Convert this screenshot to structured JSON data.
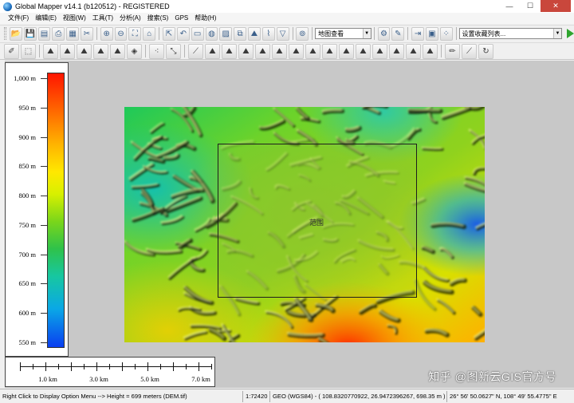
{
  "window": {
    "title": "Global Mapper v14.1 (b120512) - REGISTERED",
    "minimize": "—",
    "maximize": "☐",
    "close": "✕"
  },
  "menu": [
    "文件(F)",
    "编辑(E)",
    "视图(W)",
    "工具(T)",
    "分析(A)",
    "搜索(S)",
    "GPS",
    "帮助(H)"
  ],
  "toolbar": {
    "layer_combo": "地图查看",
    "config_combo": "设置收藏列表..."
  },
  "legend": {
    "unit": "m",
    "min": 540,
    "max": 1010,
    "ticks": [
      "1,000 m",
      "950 m",
      "900 m",
      "850 m",
      "800 m",
      "750 m",
      "700 m",
      "650 m",
      "600 m",
      "550 m"
    ],
    "tick_values": [
      1000,
      950,
      900,
      850,
      800,
      750,
      700,
      650,
      600,
      550
    ]
  },
  "scale": {
    "labels": [
      "1.0 km",
      "3.0 km",
      "5.0 km",
      "7.0 km"
    ]
  },
  "map": {
    "center_label": "范围"
  },
  "watermark": "知乎 @图新云GIS官方号",
  "status": {
    "message": "Right Click to Display Option Menu --> Height = 699 meters (DEM.tif)",
    "scale": "1:72420",
    "coords": "GEO (WGS84) - ( 108.8320770922, 26.9472396267, 698.35 m )",
    "dms": "26° 56' 50.0627\" N, 108° 49' 55.4775\" E"
  },
  "colors": {
    "legend_top": "#ff1500",
    "legend_bottom": "#0a3ef0",
    "close_button": "#c9473c",
    "map_background": "#c8c8c8"
  }
}
